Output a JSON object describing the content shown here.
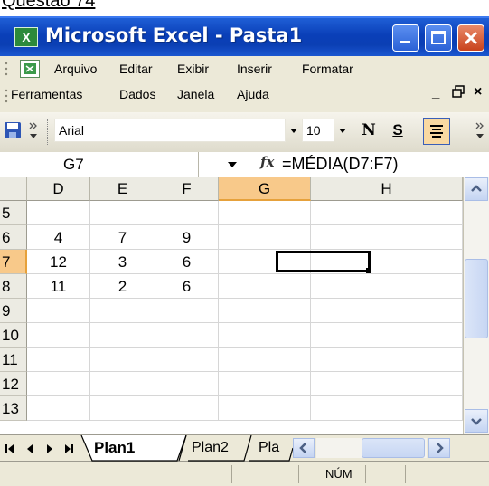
{
  "caption": "Questão 74",
  "window": {
    "title": "Microsoft Excel - Pasta1"
  },
  "menu": {
    "row1": [
      "Arquivo",
      "Editar",
      "Exibir",
      "Inserir",
      "Formatar"
    ],
    "row2": [
      "Ferramentas",
      "Dados",
      "Janela",
      "Ajuda"
    ],
    "doc_min": "_",
    "doc_restore": "ə",
    "doc_close": "×"
  },
  "toolbar": {
    "font_name": "Arial",
    "font_size": "10",
    "bold": "N",
    "underline": "S"
  },
  "formula_bar": {
    "name_box": "G7",
    "fx": "fx",
    "formula": "=MÉDIA(D7:F7)"
  },
  "grid": {
    "columns": [
      "D",
      "E",
      "F",
      "G",
      "H"
    ],
    "selected_column": "G",
    "rows": [
      {
        "num": "5",
        "cells": [
          "",
          "",
          "",
          "",
          ""
        ]
      },
      {
        "num": "6",
        "cells": [
          "4",
          "7",
          "9",
          "",
          ""
        ]
      },
      {
        "num": "7",
        "cells": [
          "12",
          "3",
          "6",
          "",
          ""
        ]
      },
      {
        "num": "8",
        "cells": [
          "11",
          "2",
          "6",
          "",
          ""
        ]
      },
      {
        "num": "9",
        "cells": [
          "",
          "",
          "",
          "",
          ""
        ]
      },
      {
        "num": "10",
        "cells": [
          "",
          "",
          "",
          "",
          ""
        ]
      },
      {
        "num": "11",
        "cells": [
          "",
          "",
          "",
          "",
          ""
        ]
      },
      {
        "num": "12",
        "cells": [
          "",
          "",
          "",
          "",
          ""
        ]
      },
      {
        "num": "13",
        "cells": [
          "",
          "",
          "",
          "",
          ""
        ]
      }
    ],
    "selected_row": "7",
    "active_cell": "G7"
  },
  "sheets": {
    "tabs": [
      "Plan1",
      "Plan2",
      "Pla"
    ],
    "active": "Plan1"
  },
  "status": {
    "num": "NÚM"
  },
  "colors": {
    "title_bar": "#0b3fb4",
    "selected_header": "#f8c98a",
    "close_button": "#c8421c"
  }
}
